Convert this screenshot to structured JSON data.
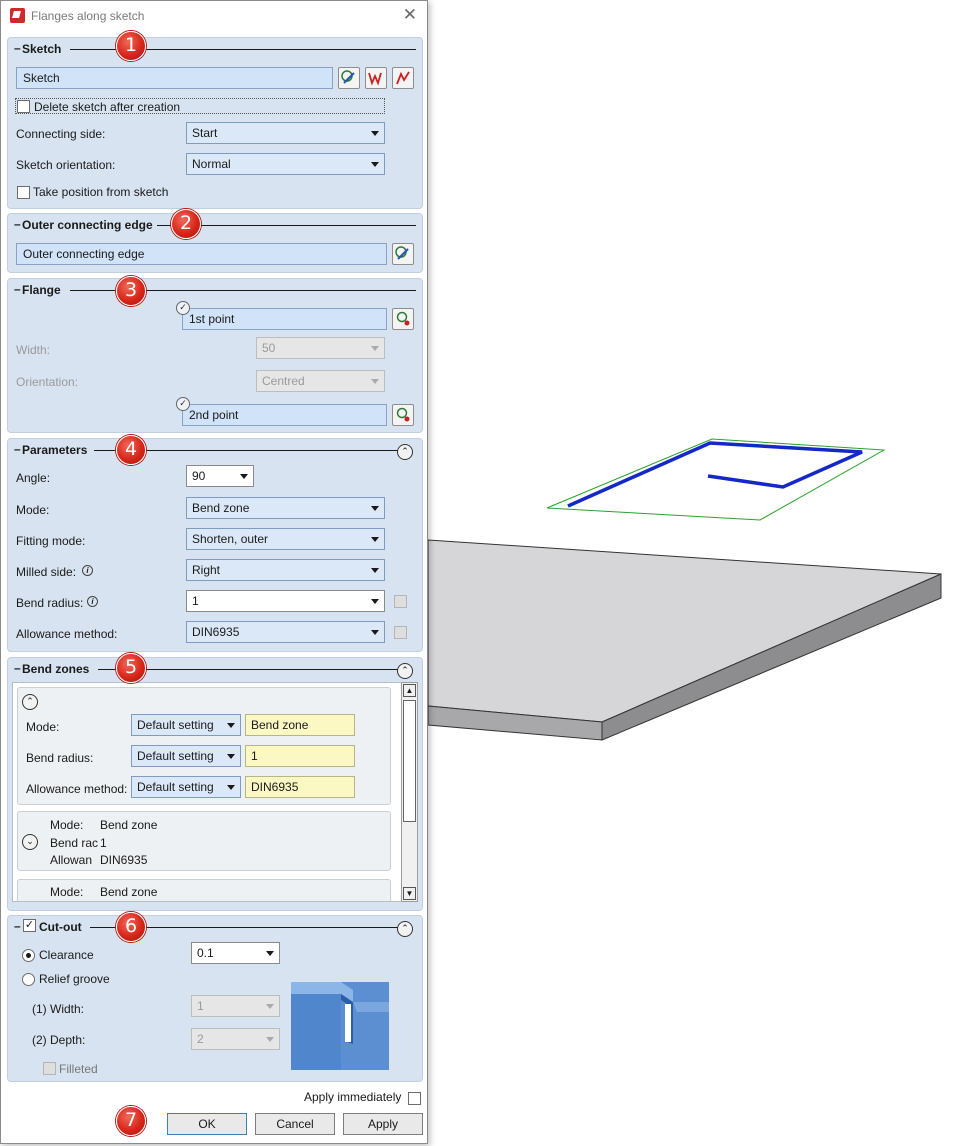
{
  "dialog": {
    "title": "Flanges along sketch"
  },
  "badges": [
    "1",
    "2",
    "3",
    "4",
    "5",
    "6",
    "7"
  ],
  "sketch": {
    "title": "Sketch",
    "field": "Sketch",
    "delete_label": "Delete sketch after creation",
    "connecting_side_label": "Connecting side:",
    "connecting_side_value": "Start",
    "orientation_label": "Sketch orientation:",
    "orientation_value": "Normal",
    "take_position_label": "Take position from sketch"
  },
  "outer_edge": {
    "title": "Outer connecting edge",
    "field": "Outer connecting edge"
  },
  "flange": {
    "title": "Flange",
    "point1": "1st point",
    "width_label": "Width:",
    "width_value": "50",
    "orientation_label": "Orientation:",
    "orientation_value": "Centred",
    "point2": "2nd point"
  },
  "parameters": {
    "title": "Parameters",
    "angle_label": "Angle:",
    "angle_value": "90",
    "mode_label": "Mode:",
    "mode_value": "Bend zone",
    "fitting_label": "Fitting mode:",
    "fitting_value": "Shorten, outer",
    "milled_label": "Milled side:",
    "milled_value": "Right",
    "radius_label": "Bend radius:",
    "radius_value": "1",
    "allowance_label": "Allowance method:",
    "allowance_value": "DIN6935"
  },
  "bend_zones": {
    "title": "Bend zones",
    "mode_label": "Mode:",
    "radius_label": "Bend radius:",
    "allowance_label": "Allowance method:",
    "default_setting": "Default setting",
    "mode_value": "Bend zone",
    "radius_value": "1",
    "allowance_value": "DIN6935",
    "summary1": {
      "mode_key": "Mode:",
      "mode_val": "Bend zone",
      "radius_key": "Bend rac",
      "radius_val": "1",
      "allow_key": "Allowan",
      "allow_val": "DIN6935"
    },
    "summary2": {
      "mode_key": "Mode:",
      "mode_val": "Bend zone"
    }
  },
  "cutout": {
    "title": "Cut-out",
    "clearance_label": "Clearance",
    "clearance_value": "0.1",
    "relief_label": "Relief groove",
    "width_label": "(1) Width:",
    "width_value": "1",
    "depth_label": "(2) Depth:",
    "depth_value": "2",
    "filleted_label": "Filleted"
  },
  "footer": {
    "apply_immediately": "Apply immediately",
    "ok": "OK",
    "cancel": "Cancel",
    "apply": "Apply"
  },
  "colors": {
    "panel": "#d8e3f1",
    "badge": "#d8261a",
    "sketch_line": "#1428c8"
  }
}
